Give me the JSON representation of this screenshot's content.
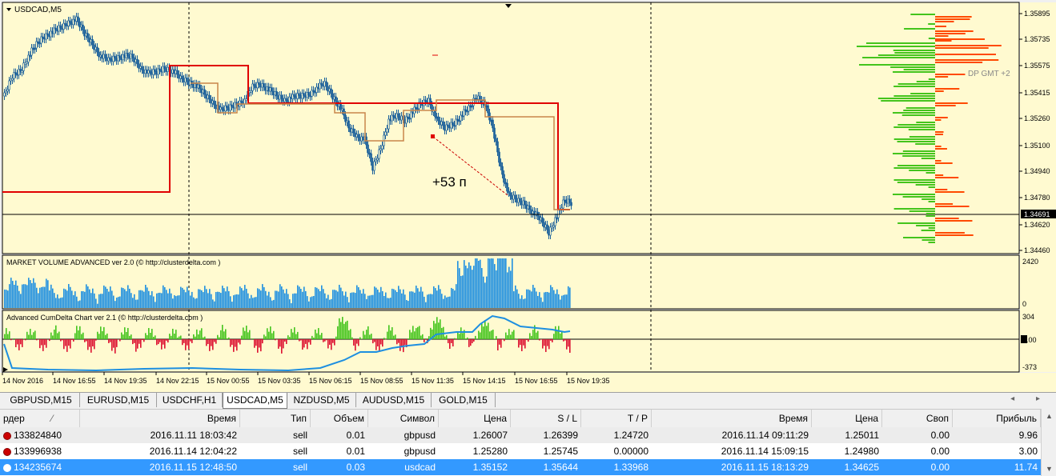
{
  "chart": {
    "symbol_title": "USDCAD,M5",
    "annotation_profit": "+53 п",
    "dp_label": "DP GMT +2",
    "current_price_label": "1.34691",
    "price_axis": [
      "1.35895",
      "1.35735",
      "1.35575",
      "1.35415",
      "1.35260",
      "1.35100",
      "1.34940",
      "1.34780",
      "1.34620",
      "1.34460"
    ],
    "time_axis": [
      "14 Nov 2016",
      "14 Nov 16:55",
      "14 Nov 19:35",
      "14 Nov 22:15",
      "15 Nov 00:55",
      "15 Nov 03:35",
      "15 Nov 06:15",
      "15 Nov 08:55",
      "15 Nov 11:35",
      "15 Nov 14:15",
      "15 Nov 16:55",
      "15 Nov 19:35"
    ],
    "volume_panel": {
      "title": "MARKET VOLUME ADVANCED ver 2.0 (© http://clusterdelta.com )",
      "axis_top": "2420",
      "axis_bottom": "0"
    },
    "cumdelta_panel": {
      "title": "Advanced CumDelta Chart ver 2.1 (© http://clusterdelta.com )",
      "axis_top": "304",
      "axis_mid": "0.00",
      "axis_bottom": "-373"
    },
    "colors": {
      "bull": "#1a7fc4",
      "bear": "#1a7fc4",
      "red_line": "#e00000",
      "orange_line": "#c8864a",
      "profile_green": "#44c41c",
      "profile_orange": "#ff4a00",
      "volume": "#1e8fe0",
      "delta_pos": "#44c41c",
      "delta_neg": "#dd1030",
      "cum_line": "#1e8fe0",
      "bg": "#fffad0"
    }
  },
  "tabs": [
    "GBPUSD,M15",
    "EURUSD,M15",
    "USDCHF,H1",
    "USDCAD,M5",
    "NZDUSD,M5",
    "AUDUSD,M15",
    "GOLD,M15"
  ],
  "active_tab": "USDCAD,M5",
  "table": {
    "headers": [
      "рдер",
      "Время",
      "Тип",
      "Объем",
      "Символ",
      "Цена",
      "S / L",
      "T / P",
      "Время",
      "Цена",
      "Своп",
      "Прибыль"
    ],
    "rows": [
      [
        "133824840",
        "2016.11.11 18:03:42",
        "sell",
        "0.01",
        "gbpusd",
        "1.26007",
        "1.26399",
        "1.24720",
        "2016.11.14 09:11:29",
        "1.25011",
        "0.00",
        "9.96"
      ],
      [
        "133996938",
        "2016.11.14 12:04:22",
        "sell",
        "0.01",
        "gbpusd",
        "1.25280",
        "1.25745",
        "0.00000",
        "2016.11.14 15:09:15",
        "1.24980",
        "0.00",
        "3.00"
      ],
      [
        "134235674",
        "2016.11.15 12:48:50",
        "sell",
        "0.03",
        "usdcad",
        "1.35152",
        "1.35644",
        "1.33968",
        "2016.11.15 18:13:29",
        "1.34625",
        "0.00",
        "11.74"
      ]
    ]
  }
}
